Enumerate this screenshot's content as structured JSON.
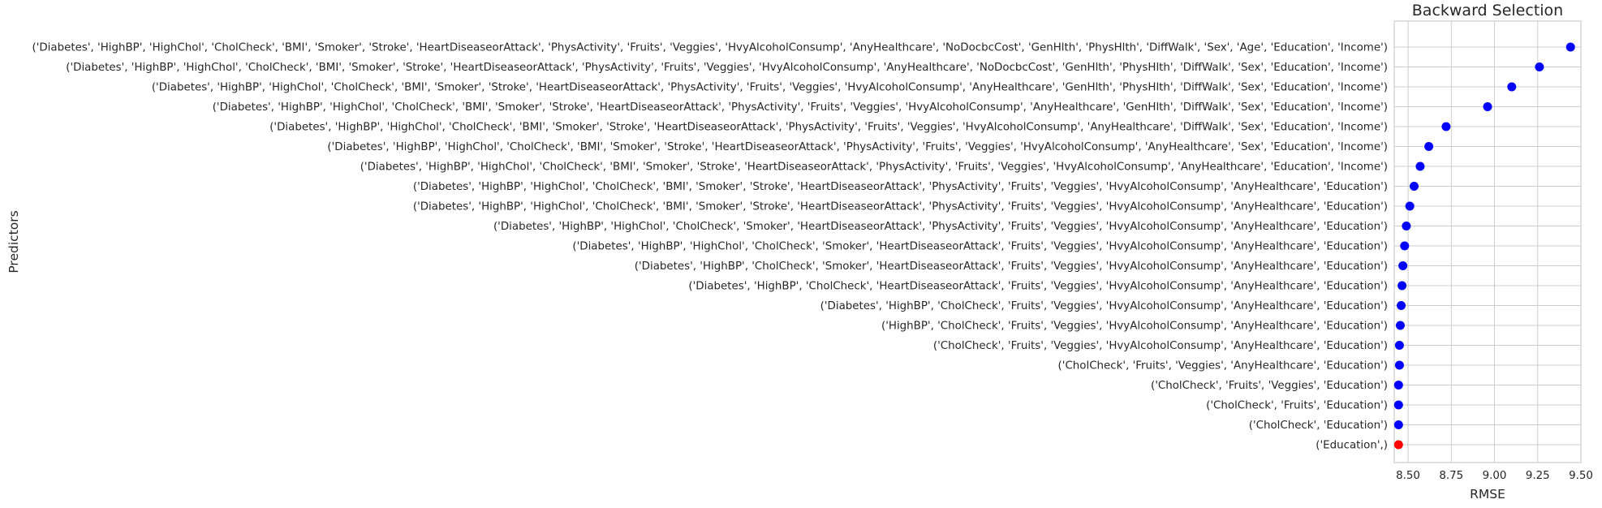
{
  "chart_data": {
    "type": "scatter",
    "title": "Backward Selection",
    "xlabel": "RMSE",
    "ylabel": "Predictors",
    "xlim": [
      8.42,
      9.5
    ],
    "xticks": [
      8.5,
      8.75,
      9.0,
      9.25,
      9.5
    ],
    "xtick_labels": [
      "8.50",
      "8.75",
      "9.00",
      "9.25",
      "9.50"
    ],
    "grid": true,
    "colors": {
      "default": "#0000ff",
      "best": "#ff0000"
    },
    "points": [
      {
        "label": "('Diabetes', 'HighBP', 'HighChol', 'CholCheck', 'BMI', 'Smoker', 'Stroke', 'HeartDiseaseorAttack', 'PhysActivity', 'Fruits', 'Veggies', 'HvyAlcoholConsump', 'AnyHealthcare', 'NoDocbcCost', 'GenHlth', 'PhysHlth', 'DiffWalk', 'Sex', 'Age', 'Education', 'Income')",
        "rmse": 9.44,
        "best": false
      },
      {
        "label": "('Diabetes', 'HighBP', 'HighChol', 'CholCheck', 'BMI', 'Smoker', 'Stroke', 'HeartDiseaseorAttack', 'PhysActivity', 'Fruits', 'Veggies', 'HvyAlcoholConsump', 'AnyHealthcare', 'NoDocbcCost', 'GenHlth', 'PhysHlth', 'DiffWalk', 'Sex', 'Education', 'Income')",
        "rmse": 9.26,
        "best": false
      },
      {
        "label": "('Diabetes', 'HighBP', 'HighChol', 'CholCheck', 'BMI', 'Smoker', 'Stroke', 'HeartDiseaseorAttack', 'PhysActivity', 'Fruits', 'Veggies', 'HvyAlcoholConsump', 'AnyHealthcare', 'GenHlth', 'PhysHlth', 'DiffWalk', 'Sex', 'Education', 'Income')",
        "rmse": 9.1,
        "best": false
      },
      {
        "label": "('Diabetes', 'HighBP', 'HighChol', 'CholCheck', 'BMI', 'Smoker', 'Stroke', 'HeartDiseaseorAttack', 'PhysActivity', 'Fruits', 'Veggies', 'HvyAlcoholConsump', 'AnyHealthcare', 'GenHlth', 'DiffWalk', 'Sex', 'Education', 'Income')",
        "rmse": 8.96,
        "best": false
      },
      {
        "label": "('Diabetes', 'HighBP', 'HighChol', 'CholCheck', 'BMI', 'Smoker', 'Stroke', 'HeartDiseaseorAttack', 'PhysActivity', 'Fruits', 'Veggies', 'HvyAlcoholConsump', 'AnyHealthcare', 'DiffWalk', 'Sex', 'Education', 'Income')",
        "rmse": 8.72,
        "best": false
      },
      {
        "label": "('Diabetes', 'HighBP', 'HighChol', 'CholCheck', 'BMI', 'Smoker', 'Stroke', 'HeartDiseaseorAttack', 'PhysActivity', 'Fruits', 'Veggies', 'HvyAlcoholConsump', 'AnyHealthcare', 'Sex', 'Education', 'Income')",
        "rmse": 8.62,
        "best": false
      },
      {
        "label": "('Diabetes', 'HighBP', 'HighChol', 'CholCheck', 'BMI', 'Smoker', 'Stroke', 'HeartDiseaseorAttack', 'PhysActivity', 'Fruits', 'Veggies', 'HvyAlcoholConsump', 'AnyHealthcare', 'Education', 'Income')",
        "rmse": 8.57,
        "best": false
      },
      {
        "label": "('Diabetes', 'HighBP', 'HighChol', 'CholCheck', 'BMI', 'Smoker', 'Stroke', 'HeartDiseaseorAttack', 'PhysActivity', 'Fruits', 'Veggies', 'HvyAlcoholConsump', 'AnyHealthcare', 'Education')",
        "rmse": 8.535,
        "best": false
      },
      {
        "label": "('Diabetes', 'HighBP', 'HighChol', 'CholCheck', 'BMI', 'Smoker', 'Stroke', 'HeartDiseaseorAttack', 'PhysActivity', 'Fruits', 'Veggies', 'HvyAlcoholConsump', 'AnyHealthcare', 'Education')",
        "rmse": 8.51,
        "best": false
      },
      {
        "label": "('Diabetes', 'HighBP', 'HighChol', 'CholCheck', 'Smoker', 'HeartDiseaseorAttack', 'PhysActivity', 'Fruits', 'Veggies', 'HvyAlcoholConsump', 'AnyHealthcare', 'Education')",
        "rmse": 8.49,
        "best": false
      },
      {
        "label": "('Diabetes', 'HighBP', 'HighChol', 'CholCheck', 'Smoker', 'HeartDiseaseorAttack', 'Fruits', 'Veggies', 'HvyAlcoholConsump', 'AnyHealthcare', 'Education')",
        "rmse": 8.48,
        "best": false
      },
      {
        "label": "('Diabetes', 'HighBP', 'CholCheck', 'Smoker', 'HeartDiseaseorAttack', 'Fruits', 'Veggies', 'HvyAlcoholConsump', 'AnyHealthcare', 'Education')",
        "rmse": 8.47,
        "best": false
      },
      {
        "label": "('Diabetes', 'HighBP', 'CholCheck', 'HeartDiseaseorAttack', 'Fruits', 'Veggies', 'HvyAlcoholConsump', 'AnyHealthcare', 'Education')",
        "rmse": 8.465,
        "best": false
      },
      {
        "label": "('Diabetes', 'HighBP', 'CholCheck', 'Fruits', 'Veggies', 'HvyAlcoholConsump', 'AnyHealthcare', 'Education')",
        "rmse": 8.46,
        "best": false
      },
      {
        "label": "('HighBP', 'CholCheck', 'Fruits', 'Veggies', 'HvyAlcoholConsump', 'AnyHealthcare', 'Education')",
        "rmse": 8.455,
        "best": false
      },
      {
        "label": "('CholCheck', 'Fruits', 'Veggies', 'HvyAlcoholConsump', 'AnyHealthcare', 'Education')",
        "rmse": 8.45,
        "best": false
      },
      {
        "label": "('CholCheck', 'Fruits', 'Veggies', 'AnyHealthcare', 'Education')",
        "rmse": 8.45,
        "best": false
      },
      {
        "label": "('CholCheck', 'Fruits', 'Veggies', 'Education')",
        "rmse": 8.445,
        "best": false
      },
      {
        "label": "('CholCheck', 'Fruits', 'Education')",
        "rmse": 8.445,
        "best": false
      },
      {
        "label": "('CholCheck', 'Education')",
        "rmse": 8.445,
        "best": false
      },
      {
        "label": "('Education',)",
        "rmse": 8.445,
        "best": true
      }
    ]
  }
}
